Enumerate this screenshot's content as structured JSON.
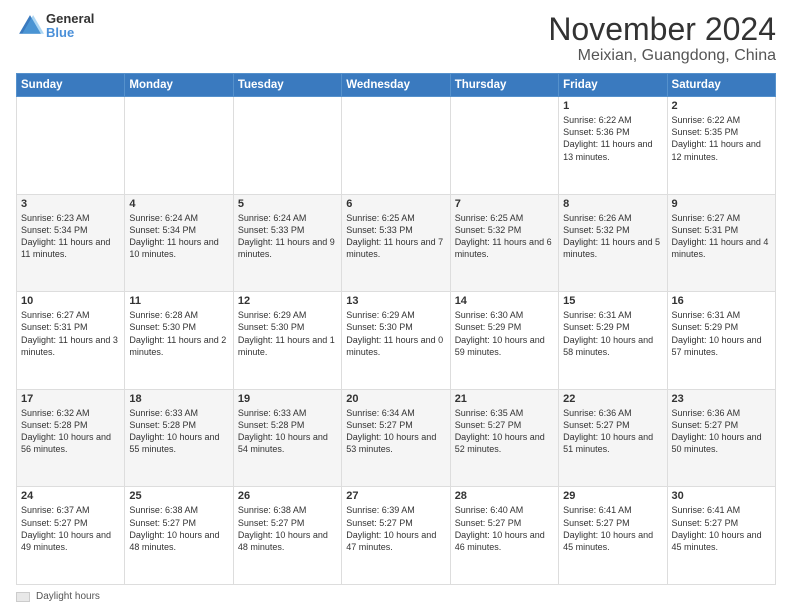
{
  "header": {
    "logo_general": "General",
    "logo_blue": "Blue",
    "title": "November 2024",
    "subtitle": "Meixian, Guangdong, China"
  },
  "calendar": {
    "days_of_week": [
      "Sunday",
      "Monday",
      "Tuesday",
      "Wednesday",
      "Thursday",
      "Friday",
      "Saturday"
    ],
    "weeks": [
      {
        "days": [
          {
            "num": "",
            "info": ""
          },
          {
            "num": "",
            "info": ""
          },
          {
            "num": "",
            "info": ""
          },
          {
            "num": "",
            "info": ""
          },
          {
            "num": "",
            "info": ""
          },
          {
            "num": "1",
            "info": "Sunrise: 6:22 AM\nSunset: 5:36 PM\nDaylight: 11 hours and 13 minutes."
          },
          {
            "num": "2",
            "info": "Sunrise: 6:22 AM\nSunset: 5:35 PM\nDaylight: 11 hours and 12 minutes."
          }
        ]
      },
      {
        "days": [
          {
            "num": "3",
            "info": "Sunrise: 6:23 AM\nSunset: 5:34 PM\nDaylight: 11 hours and 11 minutes."
          },
          {
            "num": "4",
            "info": "Sunrise: 6:24 AM\nSunset: 5:34 PM\nDaylight: 11 hours and 10 minutes."
          },
          {
            "num": "5",
            "info": "Sunrise: 6:24 AM\nSunset: 5:33 PM\nDaylight: 11 hours and 9 minutes."
          },
          {
            "num": "6",
            "info": "Sunrise: 6:25 AM\nSunset: 5:33 PM\nDaylight: 11 hours and 7 minutes."
          },
          {
            "num": "7",
            "info": "Sunrise: 6:25 AM\nSunset: 5:32 PM\nDaylight: 11 hours and 6 minutes."
          },
          {
            "num": "8",
            "info": "Sunrise: 6:26 AM\nSunset: 5:32 PM\nDaylight: 11 hours and 5 minutes."
          },
          {
            "num": "9",
            "info": "Sunrise: 6:27 AM\nSunset: 5:31 PM\nDaylight: 11 hours and 4 minutes."
          }
        ]
      },
      {
        "days": [
          {
            "num": "10",
            "info": "Sunrise: 6:27 AM\nSunset: 5:31 PM\nDaylight: 11 hours and 3 minutes."
          },
          {
            "num": "11",
            "info": "Sunrise: 6:28 AM\nSunset: 5:30 PM\nDaylight: 11 hours and 2 minutes."
          },
          {
            "num": "12",
            "info": "Sunrise: 6:29 AM\nSunset: 5:30 PM\nDaylight: 11 hours and 1 minute."
          },
          {
            "num": "13",
            "info": "Sunrise: 6:29 AM\nSunset: 5:30 PM\nDaylight: 11 hours and 0 minutes."
          },
          {
            "num": "14",
            "info": "Sunrise: 6:30 AM\nSunset: 5:29 PM\nDaylight: 10 hours and 59 minutes."
          },
          {
            "num": "15",
            "info": "Sunrise: 6:31 AM\nSunset: 5:29 PM\nDaylight: 10 hours and 58 minutes."
          },
          {
            "num": "16",
            "info": "Sunrise: 6:31 AM\nSunset: 5:29 PM\nDaylight: 10 hours and 57 minutes."
          }
        ]
      },
      {
        "days": [
          {
            "num": "17",
            "info": "Sunrise: 6:32 AM\nSunset: 5:28 PM\nDaylight: 10 hours and 56 minutes."
          },
          {
            "num": "18",
            "info": "Sunrise: 6:33 AM\nSunset: 5:28 PM\nDaylight: 10 hours and 55 minutes."
          },
          {
            "num": "19",
            "info": "Sunrise: 6:33 AM\nSunset: 5:28 PM\nDaylight: 10 hours and 54 minutes."
          },
          {
            "num": "20",
            "info": "Sunrise: 6:34 AM\nSunset: 5:27 PM\nDaylight: 10 hours and 53 minutes."
          },
          {
            "num": "21",
            "info": "Sunrise: 6:35 AM\nSunset: 5:27 PM\nDaylight: 10 hours and 52 minutes."
          },
          {
            "num": "22",
            "info": "Sunrise: 6:36 AM\nSunset: 5:27 PM\nDaylight: 10 hours and 51 minutes."
          },
          {
            "num": "23",
            "info": "Sunrise: 6:36 AM\nSunset: 5:27 PM\nDaylight: 10 hours and 50 minutes."
          }
        ]
      },
      {
        "days": [
          {
            "num": "24",
            "info": "Sunrise: 6:37 AM\nSunset: 5:27 PM\nDaylight: 10 hours and 49 minutes."
          },
          {
            "num": "25",
            "info": "Sunrise: 6:38 AM\nSunset: 5:27 PM\nDaylight: 10 hours and 48 minutes."
          },
          {
            "num": "26",
            "info": "Sunrise: 6:38 AM\nSunset: 5:27 PM\nDaylight: 10 hours and 48 minutes."
          },
          {
            "num": "27",
            "info": "Sunrise: 6:39 AM\nSunset: 5:27 PM\nDaylight: 10 hours and 47 minutes."
          },
          {
            "num": "28",
            "info": "Sunrise: 6:40 AM\nSunset: 5:27 PM\nDaylight: 10 hours and 46 minutes."
          },
          {
            "num": "29",
            "info": "Sunrise: 6:41 AM\nSunset: 5:27 PM\nDaylight: 10 hours and 45 minutes."
          },
          {
            "num": "30",
            "info": "Sunrise: 6:41 AM\nSunset: 5:27 PM\nDaylight: 10 hours and 45 minutes."
          }
        ]
      }
    ]
  },
  "legend": {
    "label": "Daylight hours"
  }
}
